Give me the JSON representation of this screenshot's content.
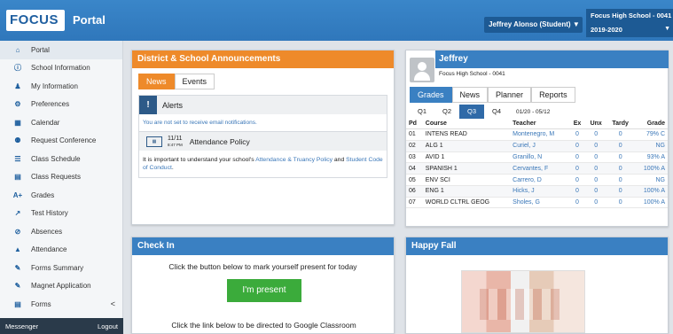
{
  "header": {
    "logo": "FOCUS",
    "title": "Portal",
    "user": "Jeffrey Alonso (Student) ▼",
    "school": "Focus High School - 0041",
    "year": "2019-2020",
    "caret": "▼"
  },
  "sidebar": {
    "items": [
      {
        "label": "Portal",
        "icon": "⌂"
      },
      {
        "label": "School Information",
        "icon": "ⓘ"
      },
      {
        "label": "My Information",
        "icon": "♟"
      },
      {
        "label": "Preferences",
        "icon": "⚙"
      },
      {
        "label": "Calendar",
        "icon": "▦"
      },
      {
        "label": "Request Conference",
        "icon": "⚉"
      },
      {
        "label": "Class Schedule",
        "icon": "☰"
      },
      {
        "label": "Class Requests",
        "icon": "▤"
      },
      {
        "label": "Grades",
        "icon": "A+"
      },
      {
        "label": "Test History",
        "icon": "↗"
      },
      {
        "label": "Absences",
        "icon": "⊘"
      },
      {
        "label": "Attendance",
        "icon": "▲"
      },
      {
        "label": "Forms Summary",
        "icon": "✎"
      },
      {
        "label": "Magnet Application",
        "icon": "✎"
      },
      {
        "label": "Forms",
        "icon": "▤"
      }
    ],
    "forms_chevron": "<",
    "messenger": "Messenger",
    "logout": "Logout"
  },
  "announcements": {
    "title": "District & School Announcements",
    "tabs": [
      "News",
      "Events"
    ],
    "alerts_title": "Alerts",
    "alerts_body": "You are not set to receive email notifications.",
    "policy_date": "11/11",
    "policy_time": "8:47 PM",
    "policy_title": "Attendance Policy",
    "policy_text1": "It is important to understand your school's ",
    "policy_link1": "Attendance & Truancy Policy",
    "policy_text2": " and ",
    "policy_link2": "Student Code of Conduct",
    "policy_text3": "."
  },
  "checkin": {
    "title": "Check In",
    "text1": "Click the button below to mark yourself present for today",
    "button": "I'm present",
    "text2": "Click the link below to be directed to Google Classroom"
  },
  "profile": {
    "name": "Jeffrey",
    "school": "Focus High School - 0041",
    "tabs": [
      "Grades",
      "News",
      "Planner",
      "Reports"
    ],
    "quarters": [
      "Q1",
      "Q2",
      "Q3",
      "Q4"
    ],
    "range": "01/20 - 05/12",
    "columns": [
      "Pd",
      "Course",
      "Teacher",
      "Ex",
      "Unx",
      "Tardy",
      "Grade"
    ],
    "rows": [
      [
        "01",
        "INTENS READ",
        "Montenegro, M",
        "0",
        "0",
        "0",
        "79% C"
      ],
      [
        "02",
        "ALG 1",
        "Curiel, J",
        "0",
        "0",
        "0",
        "NG"
      ],
      [
        "03",
        "AVID 1",
        "Granillo, N",
        "0",
        "0",
        "0",
        "93% A"
      ],
      [
        "04",
        "SPANISH 1",
        "Cervantes, F",
        "0",
        "0",
        "0",
        "100% A"
      ],
      [
        "05",
        "ENV SCI",
        "Carrero, D",
        "0",
        "0",
        "0",
        "NG"
      ],
      [
        "06",
        "ENG 1",
        "Hicks, J",
        "0",
        "0",
        "0",
        "100% A"
      ],
      [
        "07",
        "WORLD CLTRL GEOG",
        "Sholes, G",
        "0",
        "0",
        "0",
        "100% A"
      ]
    ]
  },
  "happy": {
    "title": "Happy Fall"
  }
}
